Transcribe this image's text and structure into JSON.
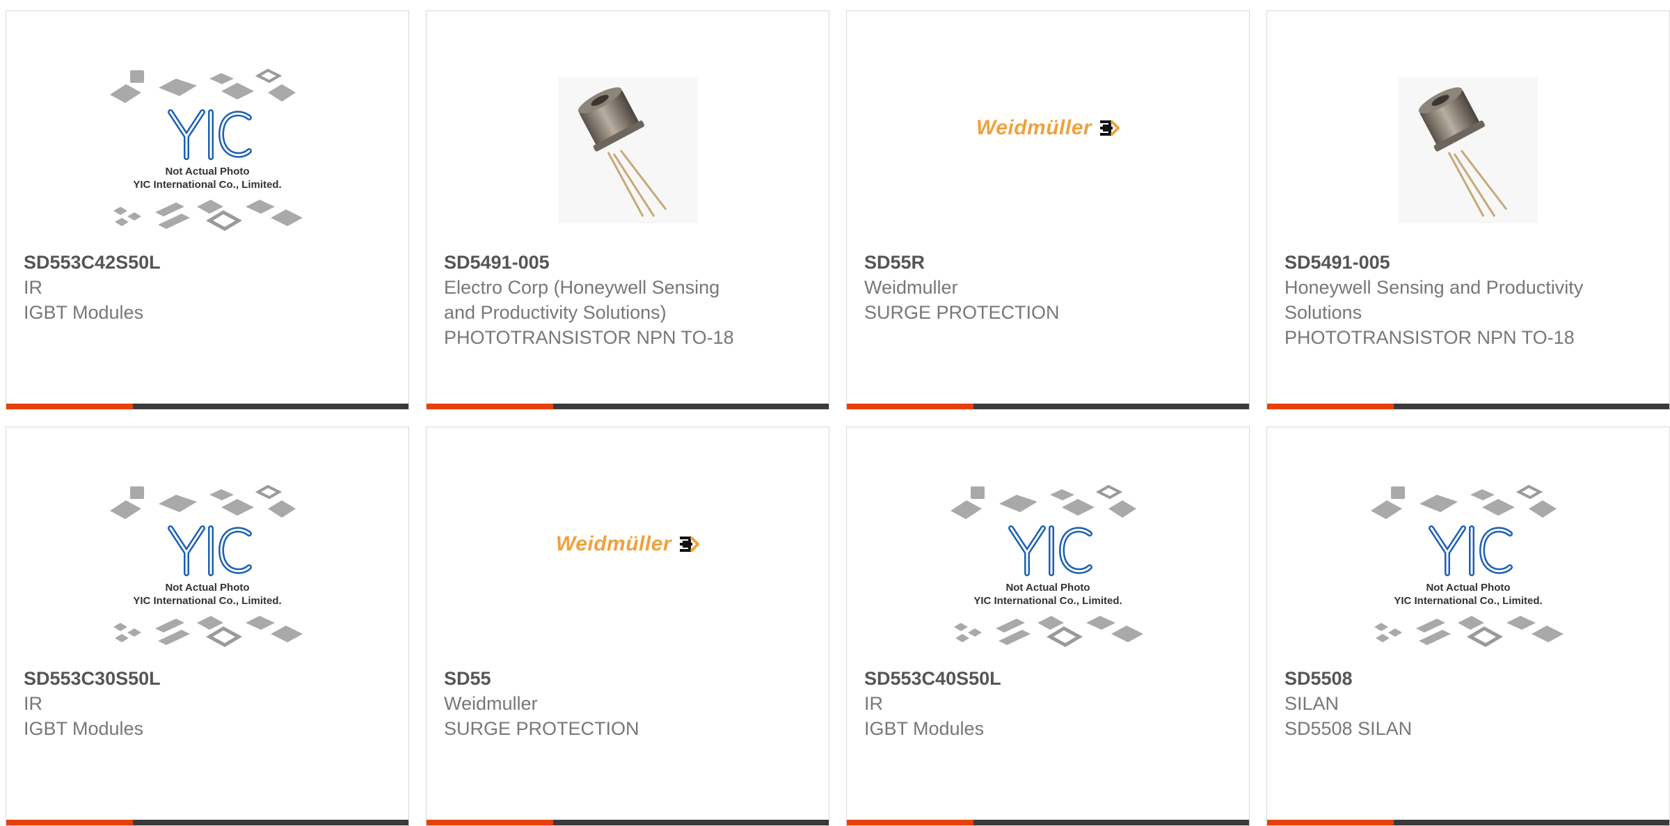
{
  "placeholder": {
    "line1": "Not Actual Photo",
    "line2": "YIC International Co., Limited.",
    "logo": "YIC"
  },
  "weidmuller_logo": "Weidmüller",
  "colors": {
    "accent": "#e6400c",
    "bar": "#3a3a3a",
    "logo_blue": "#1a5fb4",
    "weidmuller_orange": "#f0a13a"
  },
  "products": [
    {
      "part": "SD553C42S50L",
      "manufacturer": "IR",
      "desc": "IGBT Modules",
      "image": "yic-placeholder"
    },
    {
      "part": "SD5491-005",
      "manufacturer": "Electro Corp (Honeywell Sensing and Productivity Solutions)",
      "desc": "PHOTOTRANSISTOR NPN TO-18",
      "image": "phototransistor"
    },
    {
      "part": "SD55R",
      "manufacturer": "Weidmuller",
      "desc": "SURGE PROTECTION",
      "image": "weidmuller-logo"
    },
    {
      "part": "SD5491-005",
      "manufacturer": "Honeywell Sensing and Productivity Solutions",
      "desc": "PHOTOTRANSISTOR NPN TO-18",
      "image": "phototransistor"
    },
    {
      "part": "SD553C30S50L",
      "manufacturer": "IR",
      "desc": "IGBT Modules",
      "image": "yic-placeholder"
    },
    {
      "part": "SD55",
      "manufacturer": "Weidmuller",
      "desc": "SURGE PROTECTION",
      "image": "weidmuller-logo"
    },
    {
      "part": "SD553C40S50L",
      "manufacturer": "IR",
      "desc": "IGBT Modules",
      "image": "yic-placeholder"
    },
    {
      "part": "SD5508",
      "manufacturer": "SILAN",
      "desc": "SD5508 SILAN",
      "image": "yic-placeholder"
    }
  ]
}
